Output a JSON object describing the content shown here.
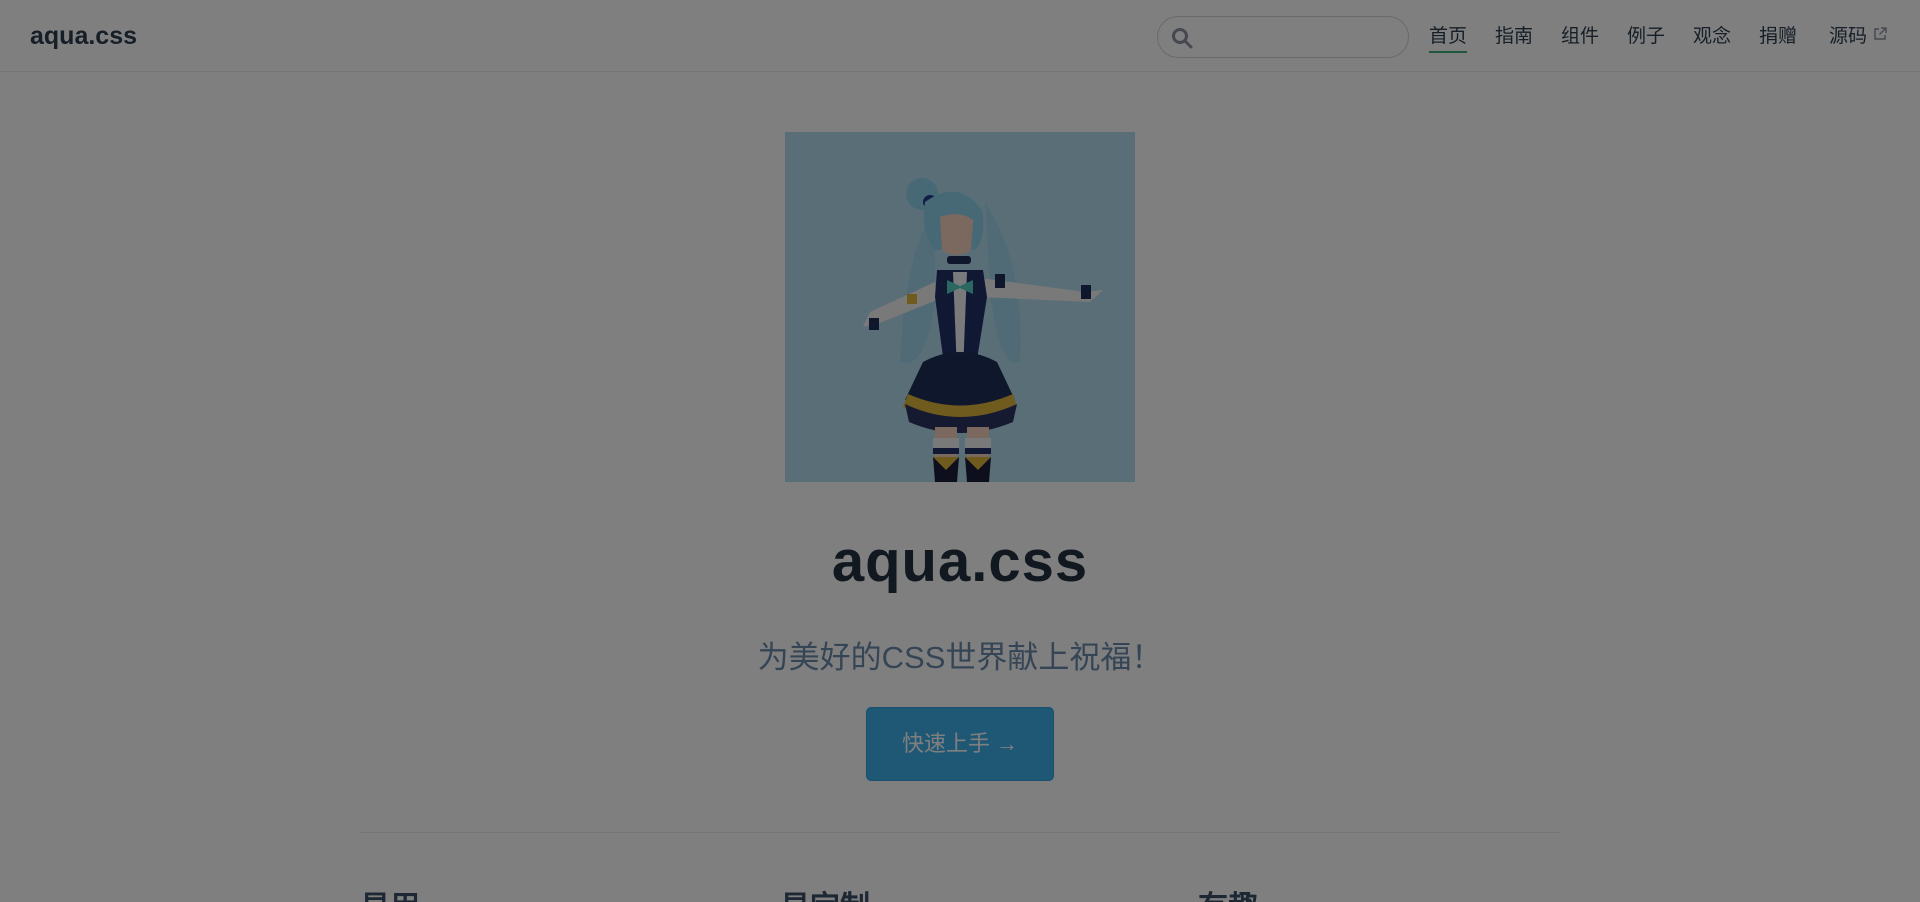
{
  "navbar": {
    "brand": "aqua.css",
    "search": {
      "value": "",
      "placeholder": ""
    },
    "links": [
      "首页",
      "指南",
      "组件",
      "例子",
      "观念",
      "捐赠",
      "源码"
    ],
    "active_index": 0
  },
  "hero": {
    "title": "aqua.css",
    "description": "为美好的CSS世界献上祝福！",
    "action_label": "快速上手 →"
  },
  "features": [
    "易用",
    "易定制",
    "有趣"
  ],
  "colors": {
    "accent": "#3eaf7c",
    "button": "#3eb0ea",
    "image_bg": "#b5ddf0",
    "overlay": "rgba(0,0,0,0.5)"
  },
  "icons": {
    "search": "search-icon",
    "external": "external-link-icon"
  }
}
